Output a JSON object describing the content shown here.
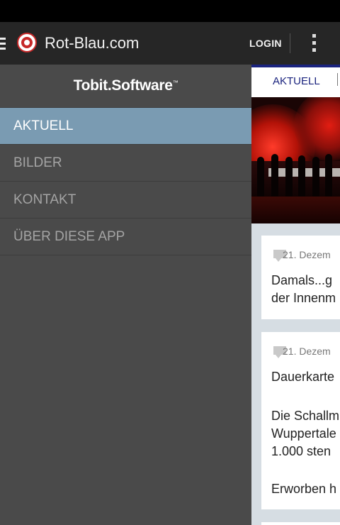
{
  "app": {
    "title": "Rot-Blau.com",
    "login_label": "LOGIN"
  },
  "drawer": {
    "brand_text": "Tobit.Software",
    "brand_mark": "™",
    "items": [
      {
        "label": "AKTUELL"
      },
      {
        "label": "BILDER"
      },
      {
        "label": "KONTAKT"
      },
      {
        "label": "ÜBER DIESE APP"
      }
    ]
  },
  "content": {
    "tab_label": "AKTUELL",
    "cards": [
      {
        "date": "21. Dezem",
        "lines": [
          "Damals...g",
          "der Innenm"
        ]
      },
      {
        "date": "21. Dezem",
        "lines": [
          "Dauerkarte",
          "",
          "Die Schallm",
          "Wuppertale",
          "1.000 sten",
          "",
          "Erworben h"
        ]
      }
    ]
  },
  "colors": {
    "active_nav": "#7a9bb2",
    "drawer_bg": "#4a4a4a",
    "action_bar": "#262626",
    "tab_accent": "#1a237e"
  }
}
